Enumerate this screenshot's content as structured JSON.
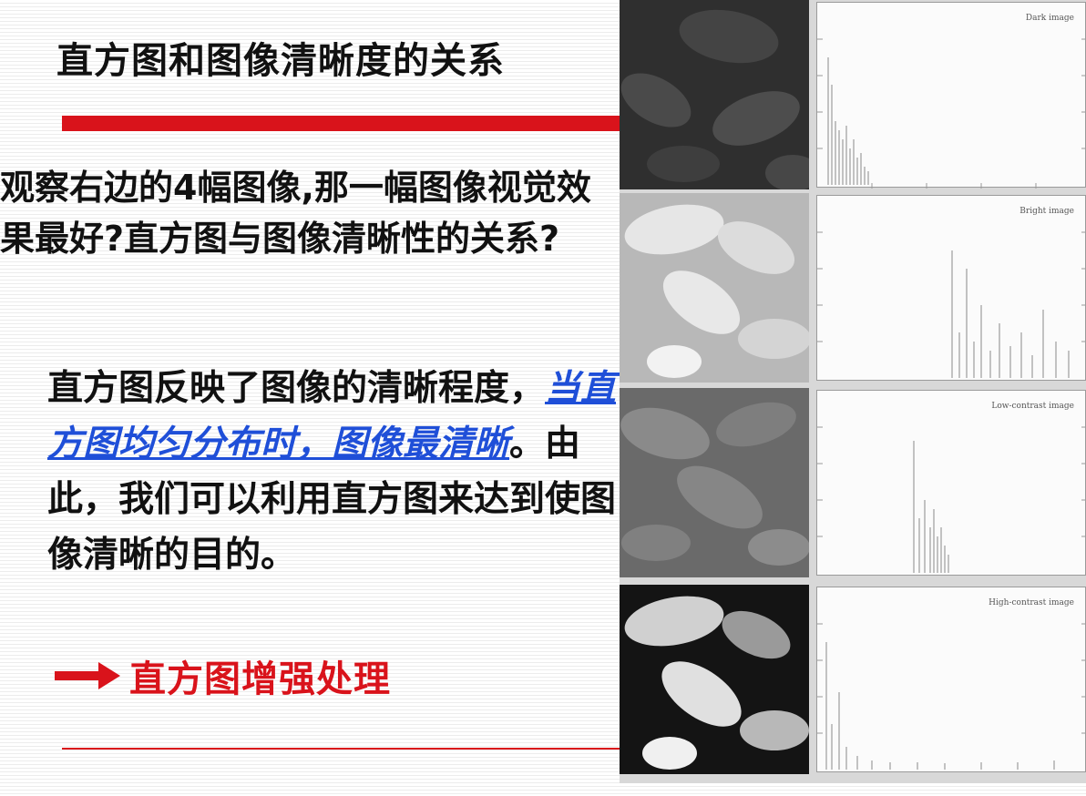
{
  "slide": {
    "title": "直方图和图像清晰度的关系",
    "question": "观察右边的4幅图像,那一幅图像视觉效果最好?直方图与图像清晰性的关系?",
    "answer_part1": "直方图反映了图像的清晰程度，",
    "answer_emphasis": "当直方图均匀分布时，图像最清晰",
    "answer_part2": "。由此，我们可以利用直方图来达到使图像清晰的目的。",
    "link_text": "直方图增强处理",
    "accent_color": "#d9131b",
    "emphasis_color": "#1f4fd8"
  },
  "figure": {
    "panels": [
      {
        "label": "Dark image",
        "photo_tone": "#2f2f2f",
        "bean_tone": "#4a4a4a"
      },
      {
        "label": "Bright image",
        "photo_tone": "#b8b8b8",
        "bean_tone": "#e6e6e6"
      },
      {
        "label": "Low-contrast image",
        "photo_tone": "#6a6a6a",
        "bean_tone": "#8a8a8a"
      },
      {
        "label": "High-contrast image",
        "photo_tone": "#141414",
        "bean_tone": "#d0d0d0"
      }
    ]
  }
}
